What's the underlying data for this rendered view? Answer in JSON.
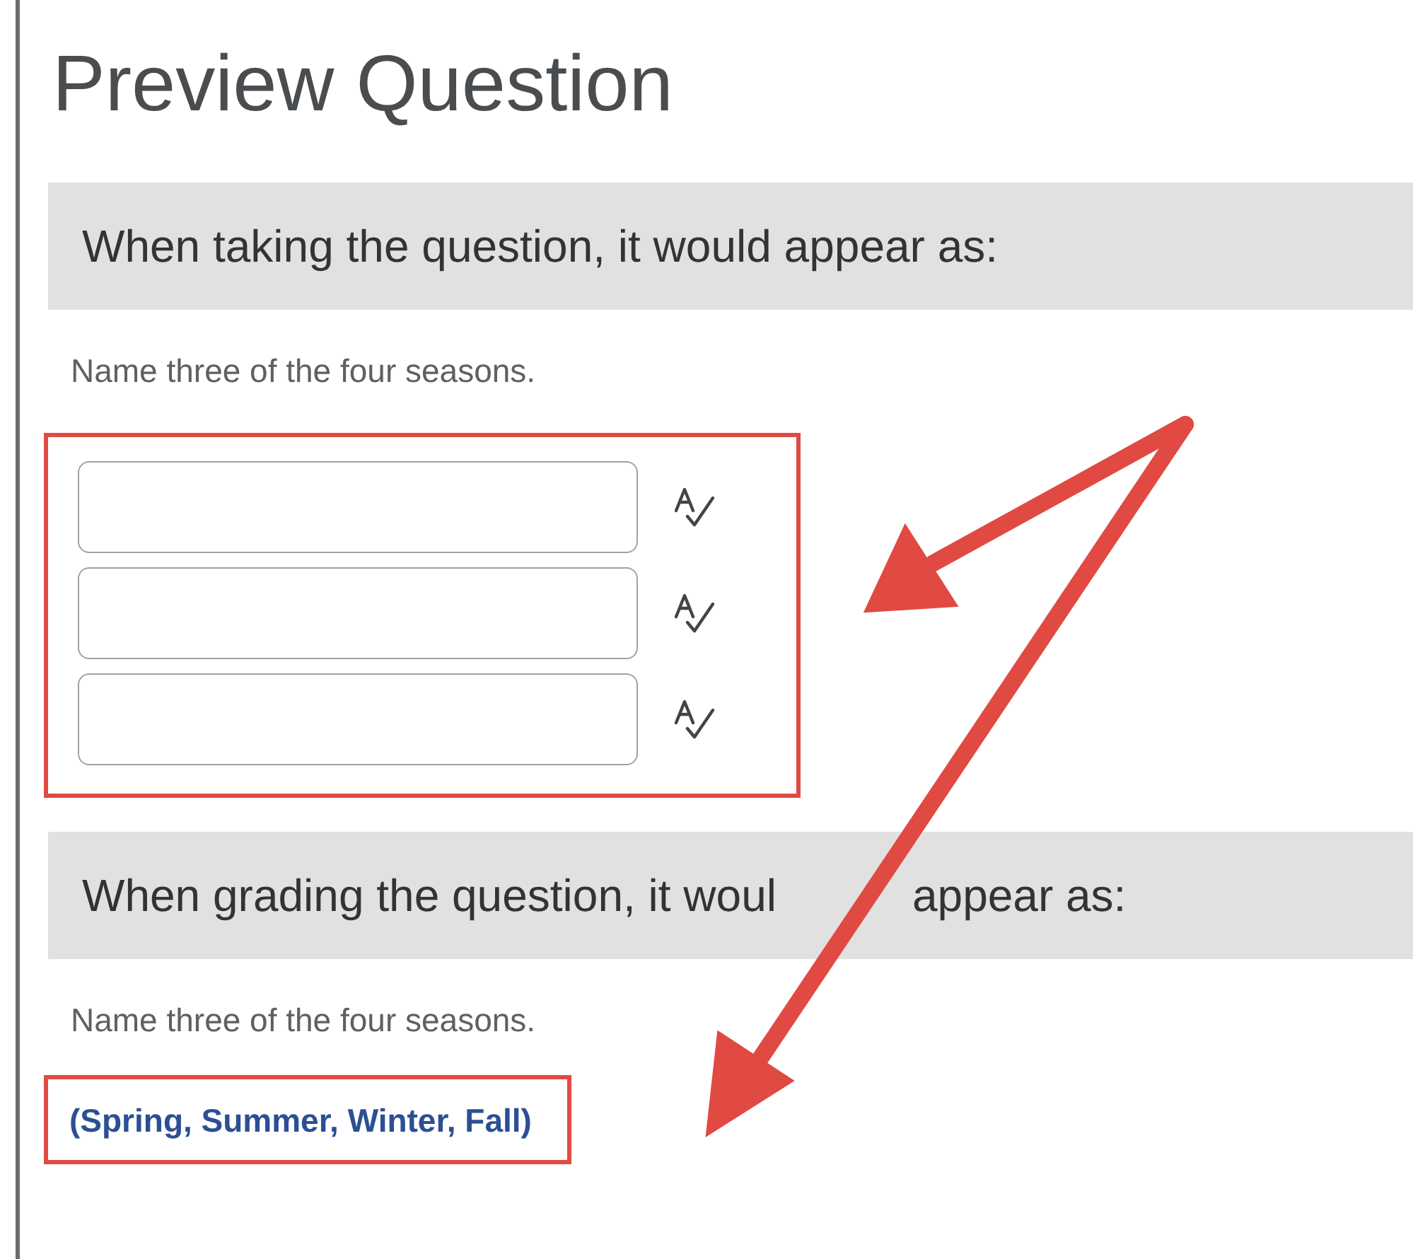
{
  "title": "Preview Question",
  "sections": [
    {
      "kind": "taking",
      "header": [
        "When taking the question, it would appear as:"
      ],
      "question": "Name three of the four seasons.",
      "highlighted": true,
      "fields": [
        {
          "spellcheck": true
        },
        {
          "spellcheck": true
        },
        {
          "spellcheck": true
        }
      ]
    },
    {
      "kind": "grading",
      "header": [
        "When grading the question, it woul",
        "appear as:"
      ],
      "question": "Name three of the four seasons.",
      "highlighted": true,
      "answer": "(Spring, Summer, Winter, Fall)"
    }
  ]
}
